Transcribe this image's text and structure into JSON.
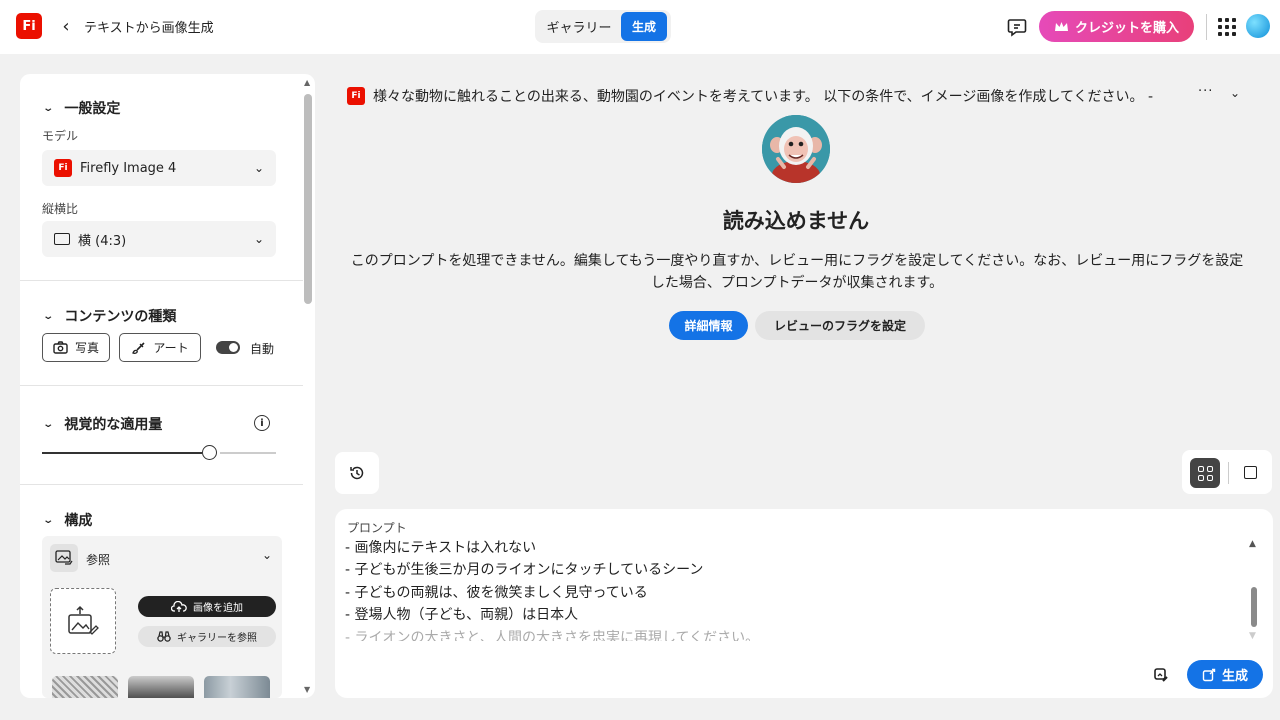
{
  "header": {
    "logo_text": "Fi",
    "back_glyph": "‹",
    "title": "テキストから画像生成",
    "tabs": {
      "gallery": "ギャラリー",
      "generate": "生成"
    },
    "buy_credits": "クレジットを購入",
    "icons": [
      "feedback-icon",
      "crown-icon",
      "apps-grid-icon",
      "user-avatar"
    ]
  },
  "sidebar": {
    "general": {
      "heading": "一般設定",
      "model_label": "モデル",
      "model_value": "Firefly Image 4",
      "ratio_label": "縦横比",
      "ratio_value": "横 (4:3)"
    },
    "content_type": {
      "heading": "コンテンツの種類",
      "photo": "写真",
      "art": "アート",
      "auto": "自動"
    },
    "visual_intensity": {
      "heading": "視覚的な適用量",
      "level": 0.72
    },
    "composition": {
      "heading": "構成",
      "reference_label": "参照",
      "add_image": "画像を追加",
      "browse_gallery": "ギャラリーを参照"
    }
  },
  "main": {
    "prompt_summary": "様々な動物に触れることの出来る、動物園のイベントを考えています。 以下の条件で、イメージ画像を作成してください。 -",
    "more": "···",
    "error_title": "読み込めません",
    "error_body": "このプロンプトを処理できません。編集してもう一度やり直すか、レビュー用にフラグを設定してください。なお、レビュー用にフラグを設定した場合、プロンプトデータが収集されます。",
    "details_button": "詳細情報",
    "flag_button": "レビューのフラグを設定"
  },
  "prompt_box": {
    "label": "プロンプト",
    "lines": [
      "- 画像内にテキストは入れない",
      "- 子どもが生後三か月のライオンにタッチしているシーン",
      "- 子どもの両親は、彼を微笑ましく見守っている",
      "- 登場人物（子ども、両親）は日本人",
      "- ライオンの大きさと、人間の大きさを忠実に再現してください。"
    ],
    "generate_button": "生成"
  },
  "colors": {
    "accent": "#1473e6",
    "brand": "#eb1000",
    "buy_gradient_start": "#e64ab9",
    "buy_gradient_end": "#e8407a"
  }
}
